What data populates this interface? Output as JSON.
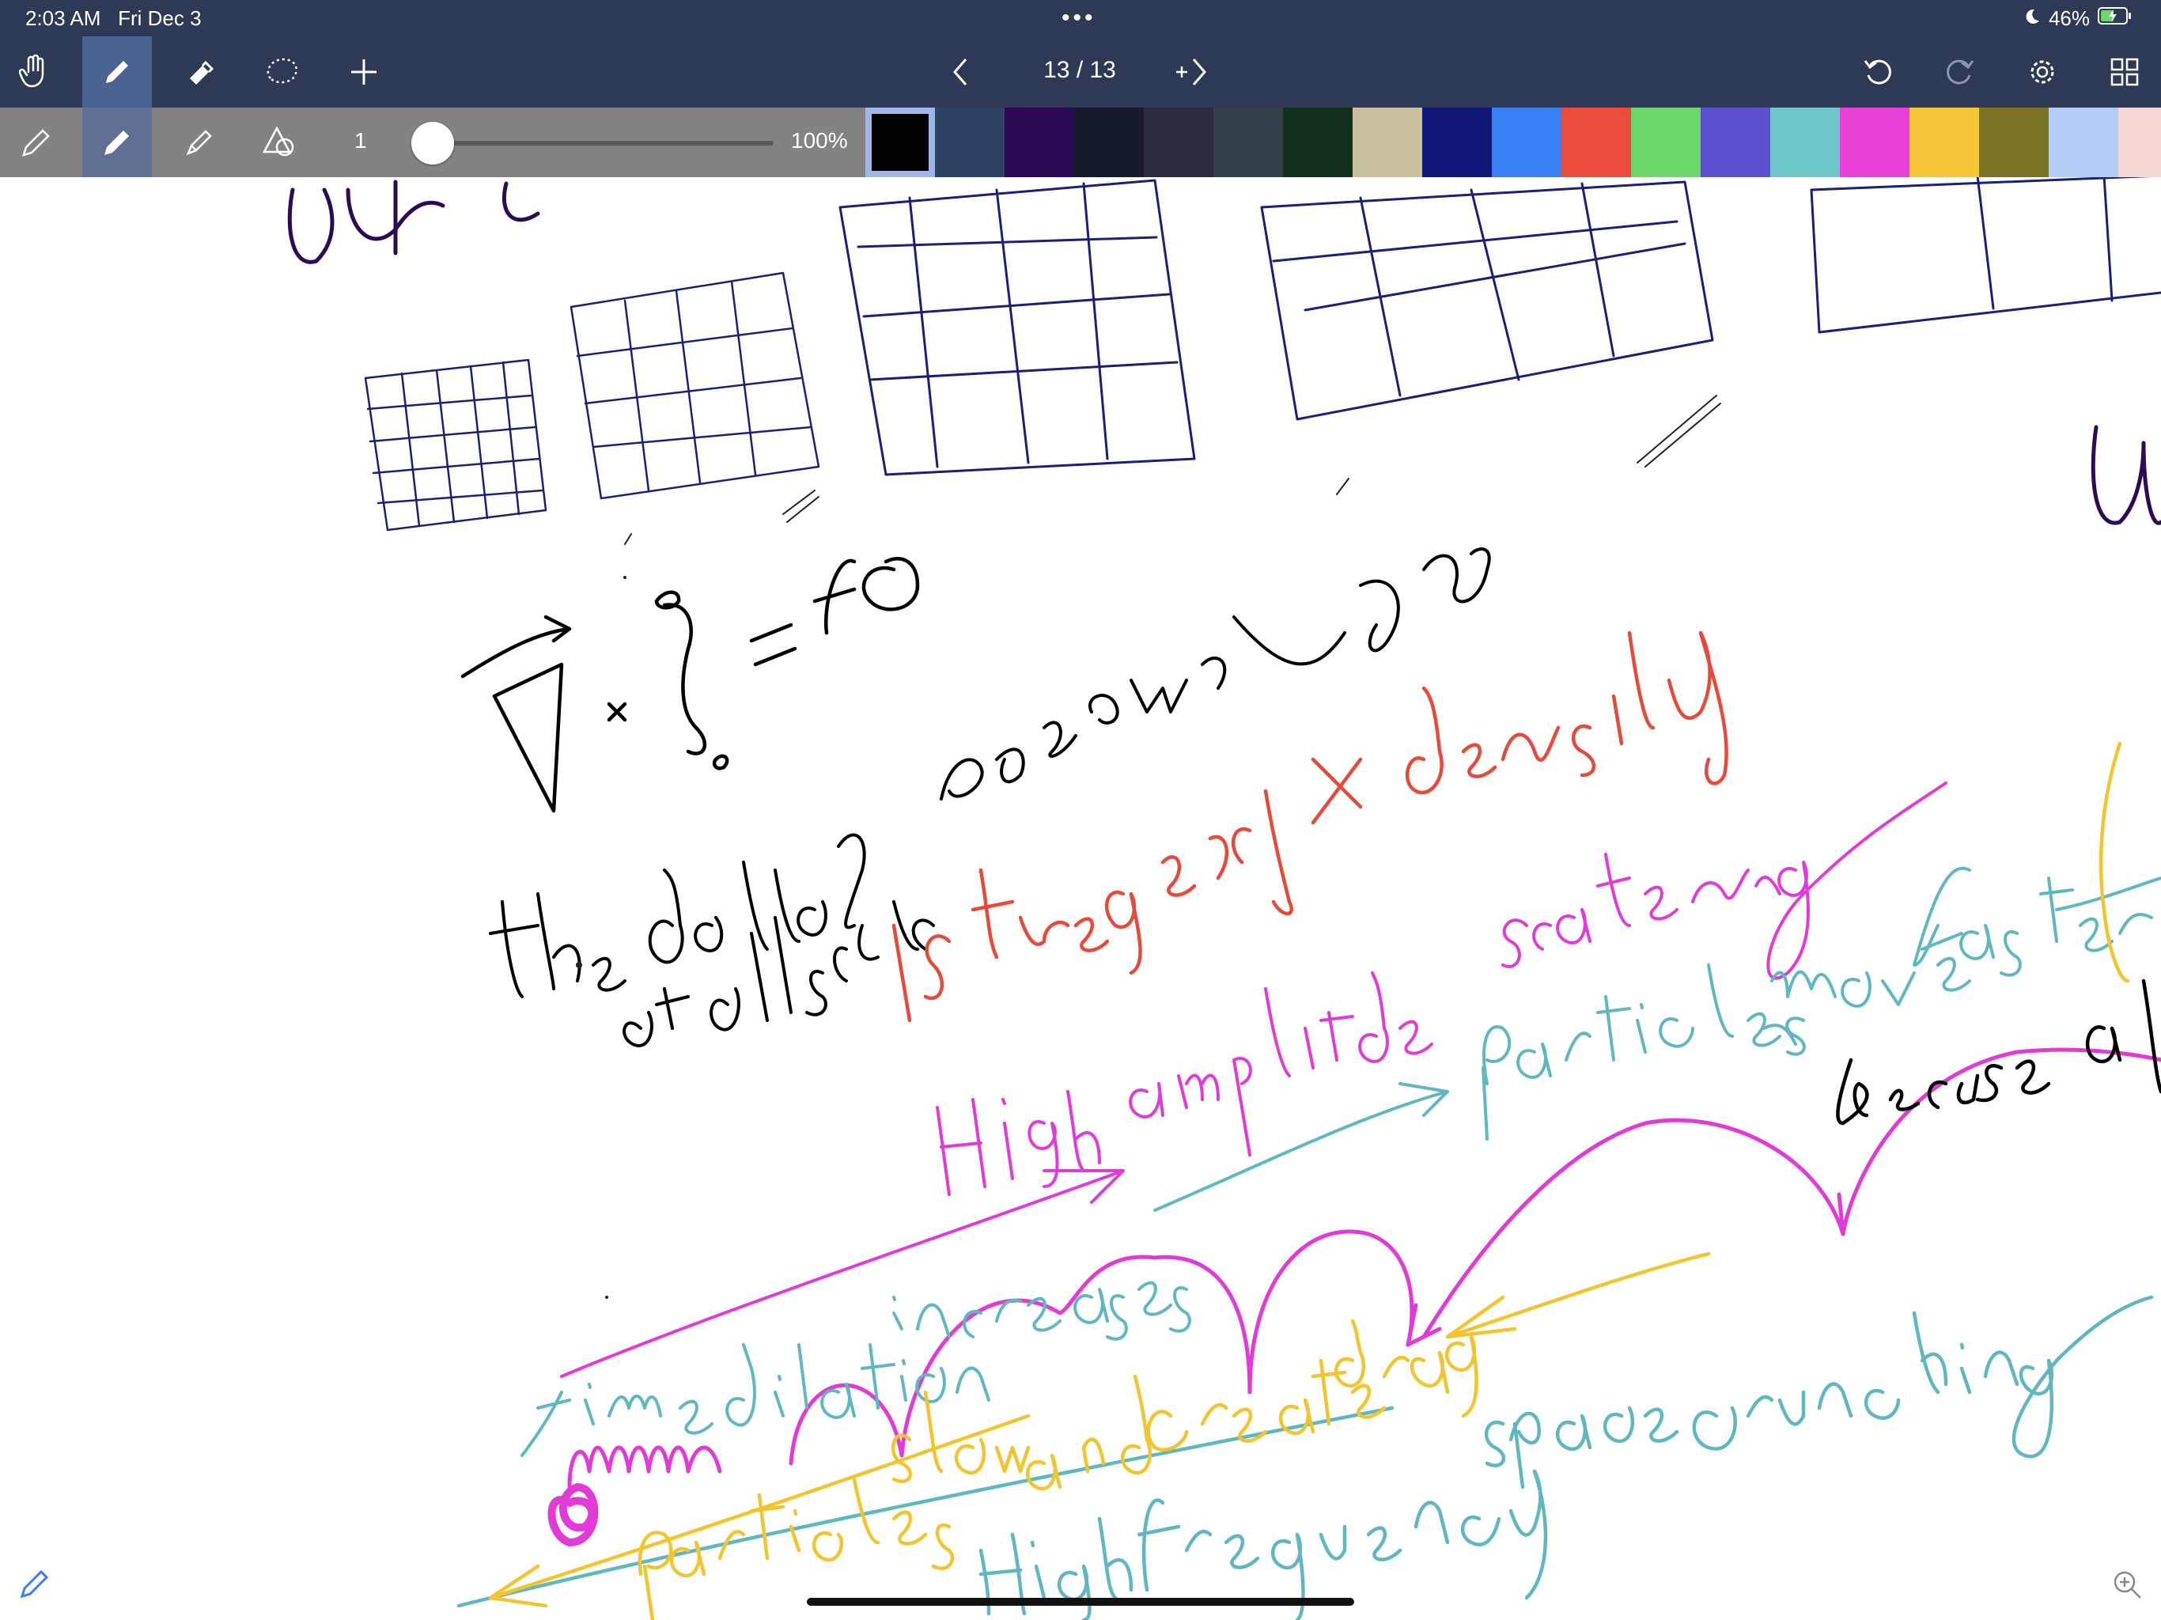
{
  "status_bar": {
    "time": "2:03 AM",
    "date": "Fri Dec 3",
    "battery": "46%"
  },
  "toolbar": {
    "page_counter": "13 / 13"
  },
  "subtoolbar": {
    "size": "1",
    "opacity": "100%"
  },
  "palette": [
    "#000000",
    "#2f4366",
    "#2d0a55",
    "#151b2b",
    "#2b2c3d",
    "#333f49",
    "#13301c",
    "#c8bf9e",
    "#111878",
    "#3a7ff1",
    "#e94b3c",
    "#6dd66b",
    "#5b51cf",
    "#6ec6c9",
    "#e940d8",
    "#f5c738",
    "#7c7325",
    "#b5cdf4",
    "#f7d6d6"
  ],
  "ink_colors": {
    "black": "#000000",
    "navy": "#1c1f7a",
    "purple": "#2d0a55",
    "red": "#e84a3a",
    "magenta": "#e23ad7",
    "teal": "#5fb8c0",
    "yellow": "#f2c42e"
  }
}
